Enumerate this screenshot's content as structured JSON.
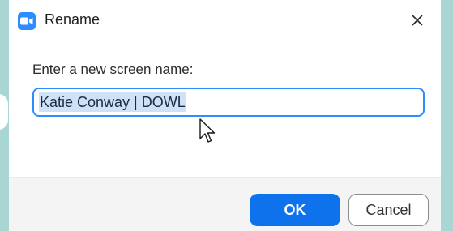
{
  "dialog": {
    "title": "Rename",
    "app_icon": "zoom-camera-icon",
    "close_icon": "close-icon"
  },
  "form": {
    "prompt_label": "Enter a new screen name:",
    "screen_name_value": "Katie Conway | DOWL",
    "text_selected": true
  },
  "footer": {
    "ok_label": "OK",
    "cancel_label": "Cancel"
  },
  "colors": {
    "accent": "#0e72ed",
    "input_border": "#2d8cff",
    "selection": "#cfe1f6",
    "backdrop": "#a9d6d2"
  }
}
